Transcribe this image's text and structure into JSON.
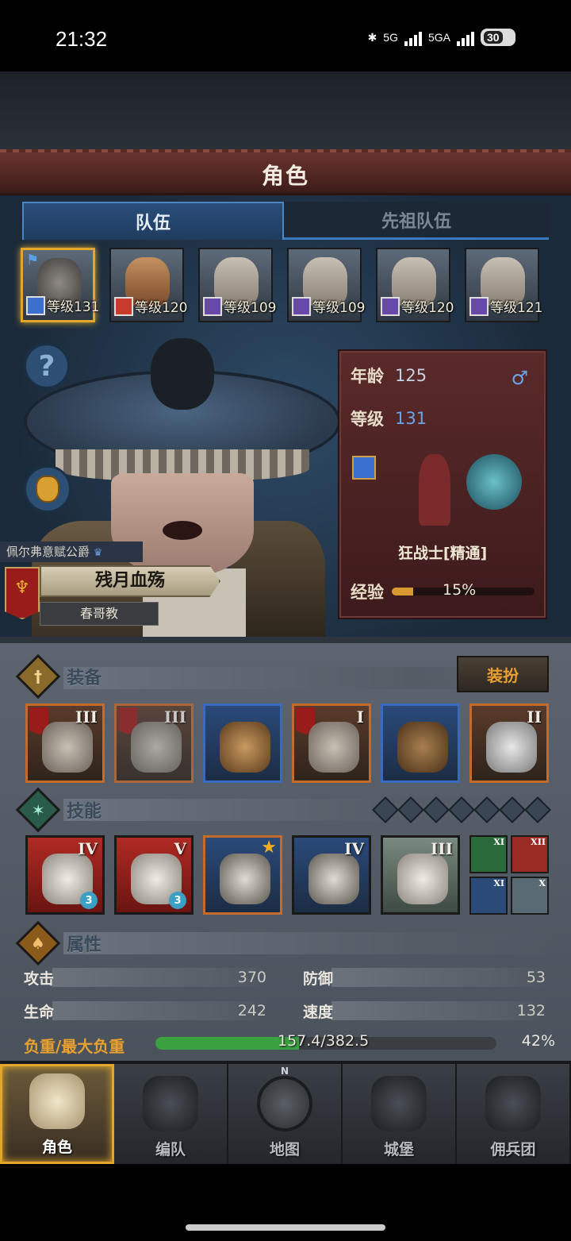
{
  "status_bar": {
    "time": "21:32",
    "network1": "5G",
    "network2": "5GA",
    "battery": "30"
  },
  "header": {
    "title": "角色"
  },
  "tabs": [
    {
      "label": "队伍",
      "active": true
    },
    {
      "label": "先祖队伍",
      "active": false
    }
  ],
  "roster": [
    {
      "level_text": "等级131",
      "selected": true
    },
    {
      "level_text": "等级120",
      "selected": false
    },
    {
      "level_text": "等级109",
      "selected": false
    },
    {
      "level_text": "等级109",
      "selected": false
    },
    {
      "level_text": "等级120",
      "selected": false
    },
    {
      "level_text": "等级121",
      "selected": false
    }
  ],
  "character": {
    "guild": "佩尔弗意赋公爵",
    "name": "残月血殇",
    "subtitle": "春哥教",
    "age_label": "年龄",
    "age": "125",
    "gender_symbol": "♂",
    "level_label": "等级",
    "level": "131",
    "class_name": "狂战士[精通]",
    "xp_label": "经验",
    "xp_percent_text": "15%",
    "xp_fraction": 0.15
  },
  "help_button": "?",
  "equipment": {
    "title": "装备",
    "dress_button": "装扮",
    "slots": [
      {
        "tier": "III",
        "style": "orange"
      },
      {
        "tier": "III",
        "style": "orange-dim"
      },
      {
        "tier": "",
        "style": "blue"
      },
      {
        "tier": "I",
        "style": "orange"
      },
      {
        "tier": "",
        "style": "blue"
      },
      {
        "tier": "II",
        "style": "orange"
      }
    ]
  },
  "skills": {
    "title": "技能",
    "slots": [
      {
        "tier": "IV",
        "gem": "3",
        "style": "red"
      },
      {
        "tier": "V",
        "gem": "3",
        "style": "red"
      },
      {
        "tier": "★",
        "gem": "",
        "style": "blue-star"
      },
      {
        "tier": "IV",
        "gem": "",
        "style": "blue"
      },
      {
        "tier": "III",
        "gem": "",
        "style": "grey"
      }
    ],
    "mini": [
      "XI",
      "XII",
      "XI",
      "X"
    ]
  },
  "attributes": {
    "title": "属性",
    "attack_label": "攻击",
    "attack": "370",
    "defense_label": "防御",
    "defense": "53",
    "hp_label": "生命",
    "hp": "242",
    "speed_label": "速度",
    "speed": "132",
    "weight_label": "负重/最大负重",
    "weight_text": "157.4/382.5",
    "weight_percent_text": "42%",
    "weight_fraction": 0.42
  },
  "nav": [
    {
      "label": "角色",
      "active": true
    },
    {
      "label": "编队",
      "active": false
    },
    {
      "label": "地图",
      "active": false,
      "compass": "N"
    },
    {
      "label": "城堡",
      "active": false
    },
    {
      "label": "佣兵团",
      "active": false
    }
  ],
  "colors": {
    "accent_gold": "#e0a72c",
    "weight_green": "#3aa040",
    "xp_orange": "#d89a30",
    "level_blue": "#6aa4e8"
  }
}
